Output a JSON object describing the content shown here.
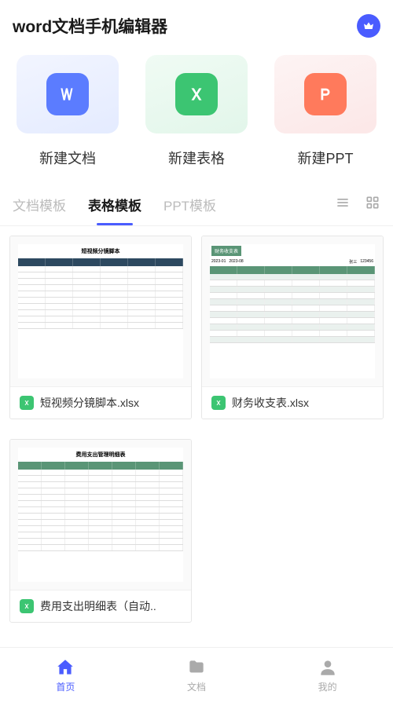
{
  "header": {
    "title": "word文档手机编辑器"
  },
  "actions": {
    "new_doc": "新建文档",
    "new_sheet": "新建表格",
    "new_ppt": "新建PPT"
  },
  "tabs": {
    "doc": "文档模板",
    "sheet": "表格模板",
    "ppt": "PPT模板",
    "active": "sheet"
  },
  "templates": [
    {
      "name": "短视频分镜脚本.xlsx"
    },
    {
      "name": "财务收支表.xlsx"
    },
    {
      "name": "费用支出明细表（自动.."
    }
  ],
  "thumb_titles": {
    "t1": "短视频分镜脚本",
    "t2": "财务收支表",
    "t3": "费用支出管理明细表"
  },
  "nav": {
    "home": "首页",
    "docs": "文档",
    "mine": "我的",
    "active": "home"
  }
}
